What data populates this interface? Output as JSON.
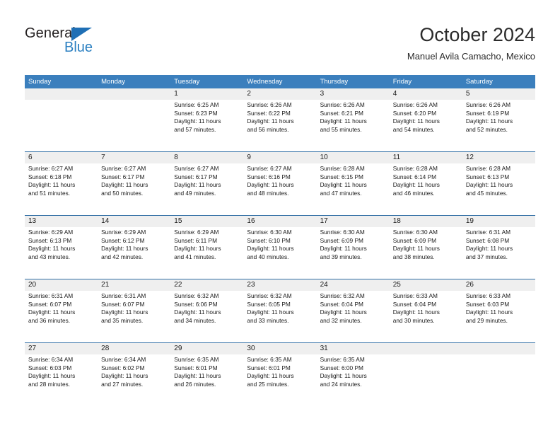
{
  "brand": {
    "name_top": "General",
    "name_bottom": "Blue",
    "accent_color": "#2a7fc1",
    "triangle_color": "#1f6fb5"
  },
  "header": {
    "title": "October 2024",
    "subtitle": "Manuel Avila Camacho, Mexico",
    "header_bg_color": "#3b7fbd",
    "row_divider_color": "#2e6da4",
    "daynum_band_color": "#efefef"
  },
  "weekdays": [
    "Sunday",
    "Monday",
    "Tuesday",
    "Wednesday",
    "Thursday",
    "Friday",
    "Saturday"
  ],
  "weeks": [
    [
      {
        "day": "",
        "lines": []
      },
      {
        "day": "",
        "lines": []
      },
      {
        "day": "1",
        "lines": [
          "Sunrise: 6:25 AM",
          "Sunset: 6:23 PM",
          "Daylight: 11 hours",
          "and 57 minutes."
        ]
      },
      {
        "day": "2",
        "lines": [
          "Sunrise: 6:26 AM",
          "Sunset: 6:22 PM",
          "Daylight: 11 hours",
          "and 56 minutes."
        ]
      },
      {
        "day": "3",
        "lines": [
          "Sunrise: 6:26 AM",
          "Sunset: 6:21 PM",
          "Daylight: 11 hours",
          "and 55 minutes."
        ]
      },
      {
        "day": "4",
        "lines": [
          "Sunrise: 6:26 AM",
          "Sunset: 6:20 PM",
          "Daylight: 11 hours",
          "and 54 minutes."
        ]
      },
      {
        "day": "5",
        "lines": [
          "Sunrise: 6:26 AM",
          "Sunset: 6:19 PM",
          "Daylight: 11 hours",
          "and 52 minutes."
        ]
      }
    ],
    [
      {
        "day": "6",
        "lines": [
          "Sunrise: 6:27 AM",
          "Sunset: 6:18 PM",
          "Daylight: 11 hours",
          "and 51 minutes."
        ]
      },
      {
        "day": "7",
        "lines": [
          "Sunrise: 6:27 AM",
          "Sunset: 6:17 PM",
          "Daylight: 11 hours",
          "and 50 minutes."
        ]
      },
      {
        "day": "8",
        "lines": [
          "Sunrise: 6:27 AM",
          "Sunset: 6:17 PM",
          "Daylight: 11 hours",
          "and 49 minutes."
        ]
      },
      {
        "day": "9",
        "lines": [
          "Sunrise: 6:27 AM",
          "Sunset: 6:16 PM",
          "Daylight: 11 hours",
          "and 48 minutes."
        ]
      },
      {
        "day": "10",
        "lines": [
          "Sunrise: 6:28 AM",
          "Sunset: 6:15 PM",
          "Daylight: 11 hours",
          "and 47 minutes."
        ]
      },
      {
        "day": "11",
        "lines": [
          "Sunrise: 6:28 AM",
          "Sunset: 6:14 PM",
          "Daylight: 11 hours",
          "and 46 minutes."
        ]
      },
      {
        "day": "12",
        "lines": [
          "Sunrise: 6:28 AM",
          "Sunset: 6:13 PM",
          "Daylight: 11 hours",
          "and 45 minutes."
        ]
      }
    ],
    [
      {
        "day": "13",
        "lines": [
          "Sunrise: 6:29 AM",
          "Sunset: 6:13 PM",
          "Daylight: 11 hours",
          "and 43 minutes."
        ]
      },
      {
        "day": "14",
        "lines": [
          "Sunrise: 6:29 AM",
          "Sunset: 6:12 PM",
          "Daylight: 11 hours",
          "and 42 minutes."
        ]
      },
      {
        "day": "15",
        "lines": [
          "Sunrise: 6:29 AM",
          "Sunset: 6:11 PM",
          "Daylight: 11 hours",
          "and 41 minutes."
        ]
      },
      {
        "day": "16",
        "lines": [
          "Sunrise: 6:30 AM",
          "Sunset: 6:10 PM",
          "Daylight: 11 hours",
          "and 40 minutes."
        ]
      },
      {
        "day": "17",
        "lines": [
          "Sunrise: 6:30 AM",
          "Sunset: 6:09 PM",
          "Daylight: 11 hours",
          "and 39 minutes."
        ]
      },
      {
        "day": "18",
        "lines": [
          "Sunrise: 6:30 AM",
          "Sunset: 6:09 PM",
          "Daylight: 11 hours",
          "and 38 minutes."
        ]
      },
      {
        "day": "19",
        "lines": [
          "Sunrise: 6:31 AM",
          "Sunset: 6:08 PM",
          "Daylight: 11 hours",
          "and 37 minutes."
        ]
      }
    ],
    [
      {
        "day": "20",
        "lines": [
          "Sunrise: 6:31 AM",
          "Sunset: 6:07 PM",
          "Daylight: 11 hours",
          "and 36 minutes."
        ]
      },
      {
        "day": "21",
        "lines": [
          "Sunrise: 6:31 AM",
          "Sunset: 6:07 PM",
          "Daylight: 11 hours",
          "and 35 minutes."
        ]
      },
      {
        "day": "22",
        "lines": [
          "Sunrise: 6:32 AM",
          "Sunset: 6:06 PM",
          "Daylight: 11 hours",
          "and 34 minutes."
        ]
      },
      {
        "day": "23",
        "lines": [
          "Sunrise: 6:32 AM",
          "Sunset: 6:05 PM",
          "Daylight: 11 hours",
          "and 33 minutes."
        ]
      },
      {
        "day": "24",
        "lines": [
          "Sunrise: 6:32 AM",
          "Sunset: 6:04 PM",
          "Daylight: 11 hours",
          "and 32 minutes."
        ]
      },
      {
        "day": "25",
        "lines": [
          "Sunrise: 6:33 AM",
          "Sunset: 6:04 PM",
          "Daylight: 11 hours",
          "and 30 minutes."
        ]
      },
      {
        "day": "26",
        "lines": [
          "Sunrise: 6:33 AM",
          "Sunset: 6:03 PM",
          "Daylight: 11 hours",
          "and 29 minutes."
        ]
      }
    ],
    [
      {
        "day": "27",
        "lines": [
          "Sunrise: 6:34 AM",
          "Sunset: 6:03 PM",
          "Daylight: 11 hours",
          "and 28 minutes."
        ]
      },
      {
        "day": "28",
        "lines": [
          "Sunrise: 6:34 AM",
          "Sunset: 6:02 PM",
          "Daylight: 11 hours",
          "and 27 minutes."
        ]
      },
      {
        "day": "29",
        "lines": [
          "Sunrise: 6:35 AM",
          "Sunset: 6:01 PM",
          "Daylight: 11 hours",
          "and 26 minutes."
        ]
      },
      {
        "day": "30",
        "lines": [
          "Sunrise: 6:35 AM",
          "Sunset: 6:01 PM",
          "Daylight: 11 hours",
          "and 25 minutes."
        ]
      },
      {
        "day": "31",
        "lines": [
          "Sunrise: 6:35 AM",
          "Sunset: 6:00 PM",
          "Daylight: 11 hours",
          "and 24 minutes."
        ]
      },
      {
        "day": "",
        "lines": []
      },
      {
        "day": "",
        "lines": []
      }
    ]
  ]
}
